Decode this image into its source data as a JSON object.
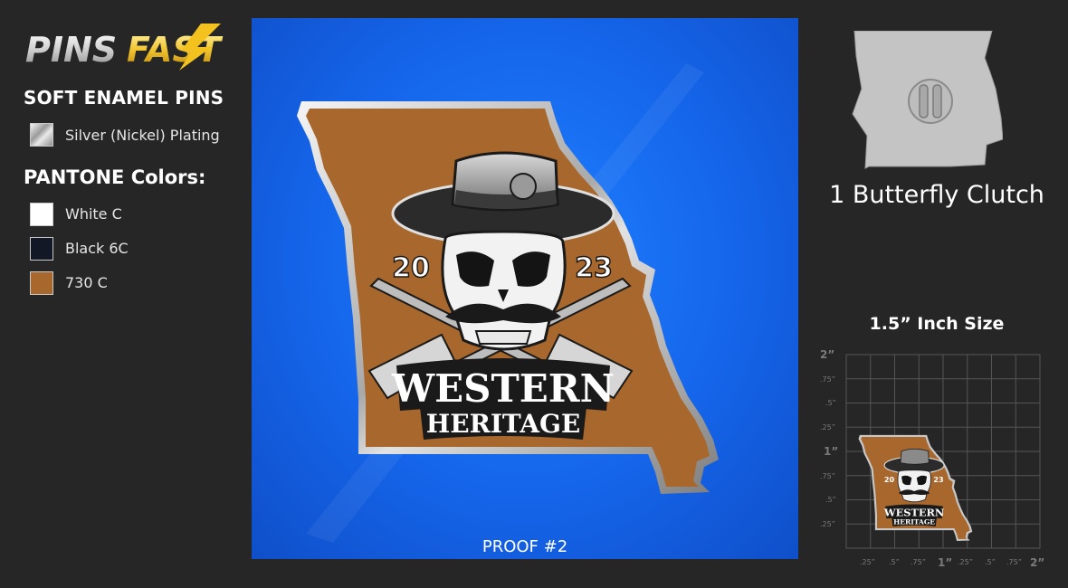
{
  "brand": {
    "logo_text_part1": "PINS",
    "logo_text_part2": "FAST"
  },
  "legend": {
    "product_title": "SOFT ENAMEL PINS",
    "plating": {
      "label": "Silver (Nickel) Plating",
      "swatch": "silver-gradient"
    },
    "pantone_title": "PANTONE Colors:",
    "pantone_colors": [
      {
        "label": "White C",
        "color": "#ffffff"
      },
      {
        "label": "Black 6C",
        "color": "#121826"
      },
      {
        "label": "730 C",
        "color": "#a8672c"
      }
    ]
  },
  "proof": {
    "background_color": "#1668ef",
    "pin": {
      "shape": "missouri-state",
      "fill_color": "#a8672c",
      "year_left": "20",
      "year_right": "23",
      "title_line1": "WESTERN",
      "title_line2": "HERITAGE"
    },
    "label": "PROOF #2"
  },
  "backing": {
    "label": "1 Butterfly Clutch"
  },
  "size": {
    "label": "1.5” Inch Size",
    "y_axis_labels": [
      "2”",
      ".75”",
      ".5”",
      ".25”",
      "1”",
      ".75”",
      ".5”",
      ".25”"
    ],
    "x_axis_labels": [
      ".25”",
      ".5”",
      ".75”",
      "1”",
      ".25”",
      ".5”",
      ".75”",
      "2”"
    ]
  }
}
